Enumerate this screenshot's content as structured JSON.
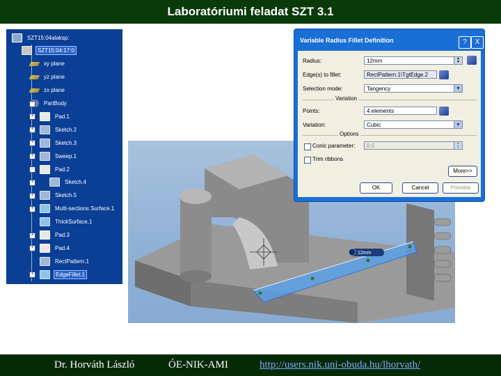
{
  "slide": {
    "title": "Laboratóriumi feladat SZT 3.1",
    "footer": {
      "author": "Dr. Horváth László",
      "institute": "ÓE-NIK-AMI",
      "url": "http://users.nik.uni-obuda.hu/lhorvath/"
    }
  },
  "tree": {
    "items": [
      {
        "label": "SZT15:04alaksp:",
        "icon": "part-document-icon"
      },
      {
        "label": "SZT15:04:17:0",
        "icon": "product-icon",
        "selected": true
      },
      {
        "label": "xy plane",
        "icon": "plane-icon"
      },
      {
        "label": "yz plane",
        "icon": "plane-icon"
      },
      {
        "label": "zx plane",
        "icon": "plane-icon"
      },
      {
        "label": "PartBody",
        "icon": "partbody-icon"
      },
      {
        "label": "Pad.1",
        "icon": "pad-icon"
      },
      {
        "label": "Sketch.2",
        "icon": "sketch-icon"
      },
      {
        "label": "Sketch.3",
        "icon": "sketch-icon"
      },
      {
        "label": "Sweep.1",
        "icon": "sweep-icon"
      },
      {
        "label": "Pad.2",
        "icon": "pad-icon"
      },
      {
        "label": "Sketch.4",
        "icon": "sketch-icon"
      },
      {
        "label": "Sketch.5",
        "icon": "sketch-icon"
      },
      {
        "label": "Multi-sections Surface.1",
        "icon": "surface-icon"
      },
      {
        "label": "ThickSurface.1",
        "icon": "surface-icon"
      },
      {
        "label": "Pad.3",
        "icon": "pad-icon"
      },
      {
        "label": "Pad.4",
        "icon": "pad-icon"
      },
      {
        "label": "RectPattern.1",
        "icon": "pattern-icon"
      },
      {
        "label": "EdgeFillet.1",
        "icon": "fillet-icon",
        "selected": true
      }
    ]
  },
  "dialog": {
    "title": "Variable Radius Fillet Definition",
    "help_label": "?",
    "close_label": "X",
    "radius_label": "Radius:",
    "radius_value": "12mm",
    "edges_label": "Edge(s) to fillet:",
    "edges_value": "RectPattern.1\\TgtEdge.2",
    "propagation_label": "Selection mode:",
    "propagation_value": "Tangency",
    "variation_section": "Variation",
    "points_label": "Points:",
    "points_value": "4 elements",
    "variation_label": "Variation:",
    "variation_value": "Cubic",
    "options_section": "Options",
    "conic_label": "Conic parameter:",
    "conic_value": "0.5",
    "trim_label": "Trim ribbons",
    "more_label": "More>>",
    "ok_label": "OK",
    "cancel_label": "Cancel",
    "preview_label": "Preview"
  },
  "viewport": {
    "annotations": [
      {
        "text": "12mm"
      }
    ]
  }
}
